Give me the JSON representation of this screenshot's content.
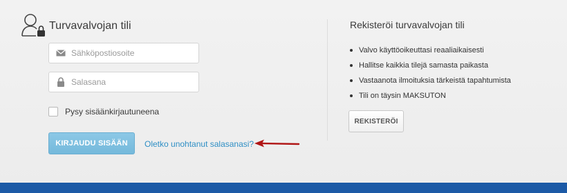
{
  "login": {
    "title": "Turvavalvojan tili",
    "email_placeholder": "Sähköpostiosoite",
    "password_placeholder": "Salasana",
    "remember_label": "Pysy sisäänkirjautuneena",
    "login_button": "KIRJAUDU SISÄÄN",
    "forgot_link": "Oletko unohtanut salasanasi?"
  },
  "register": {
    "title": "Rekisteröi turvavalvojan tili",
    "bullets": [
      "Valvo käyttöoikeuttasi reaaliaikaisesti",
      "Hallitse kaikkia tilejä samasta paikasta",
      "Vastaanota ilmoituksia tärkeistä tapahtumista",
      "Tili on täysin MAKSUTON"
    ],
    "button": "REKISTERÖI"
  },
  "icons": {
    "header": "user-lock-icon",
    "email": "envelope-icon",
    "password": "padlock-icon",
    "annotation": "red-arrow-icon"
  },
  "colors": {
    "accent_button": "#7bbede",
    "link": "#2f8fc5",
    "arrow": "#b01515",
    "footer": "#1c5aa6",
    "background": "#efefef"
  }
}
